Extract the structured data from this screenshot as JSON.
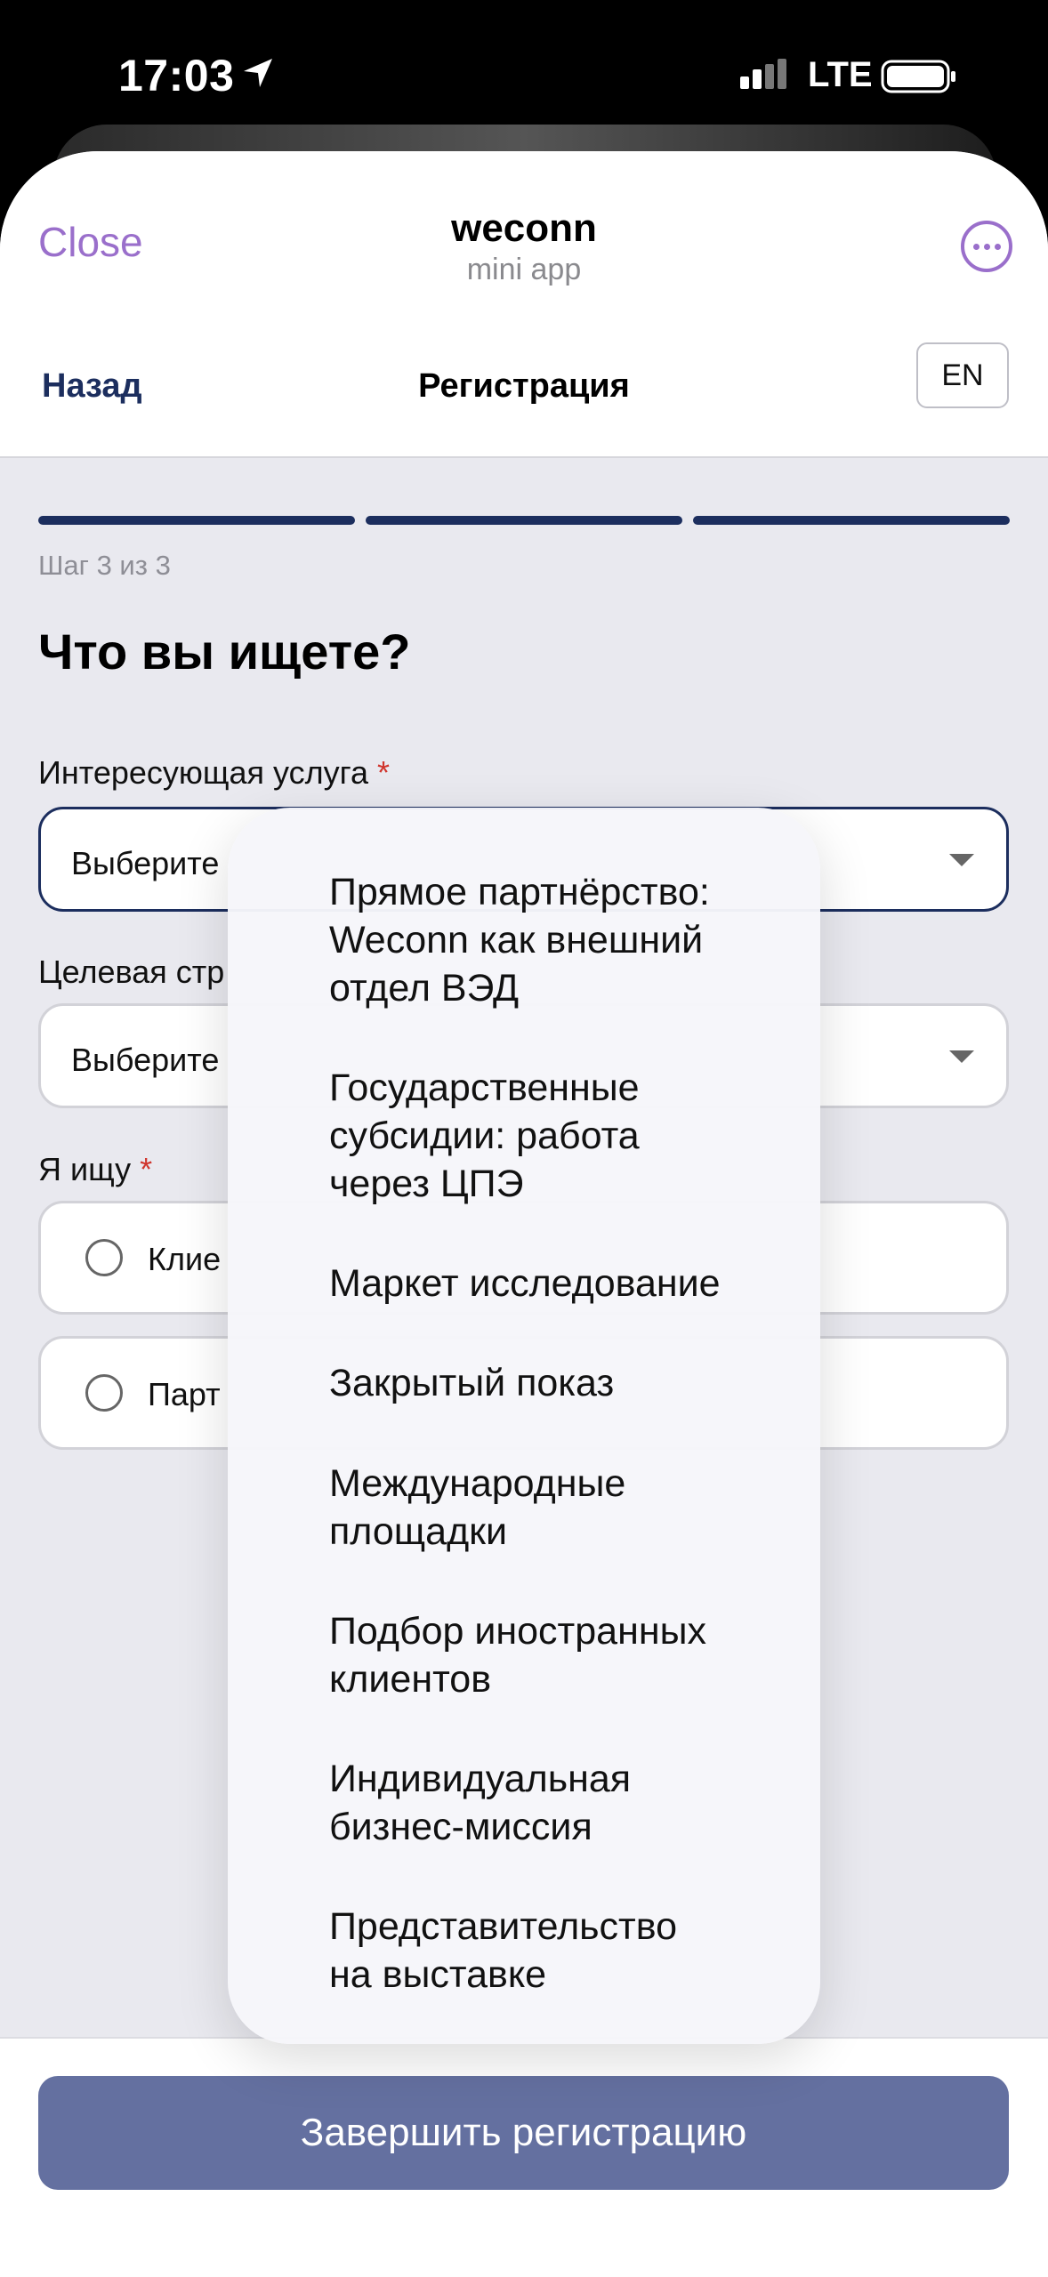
{
  "status_bar": {
    "time": "17:03",
    "network": "LTE"
  },
  "telegram_header": {
    "close_label": "Close",
    "title": "weconn",
    "subtitle": "mini app"
  },
  "app_header": {
    "back_label": "Назад",
    "title": "Регистрация",
    "lang_label": "EN"
  },
  "progress": {
    "step_label": "Шаг 3 из 3",
    "total_steps": 3,
    "completed_steps": 3
  },
  "form": {
    "heading": "Что вы ищете?",
    "service": {
      "label": "Интересующая услуга",
      "required_mark": "*",
      "placeholder": "Выберите"
    },
    "country": {
      "label": "Целевая стр",
      "placeholder": "Выберите"
    },
    "seeking": {
      "label": "Я ищу",
      "required_mark": "*",
      "options": [
        "Клие",
        "Парт"
      ]
    }
  },
  "dropdown": {
    "options": [
      "Прямое партнёрство:\nWeconn как внешний\nотдел ВЭД",
      "Государственные\nсубсидии: работа\nчерез ЦПЭ",
      "Маркет исследование",
      "Закрытый показ",
      "Международные\nплощадки",
      "Подбор иностранных\nклиентов",
      "Индивидуальная\nбизнес-миссия",
      "Представительство\nна выставке"
    ]
  },
  "submit_label": "Завершить регистрацию",
  "colors": {
    "accent_purple": "#9a6fcb",
    "navy": "#1c2e5e",
    "button": "#6470a0",
    "required": "#d0342c"
  }
}
